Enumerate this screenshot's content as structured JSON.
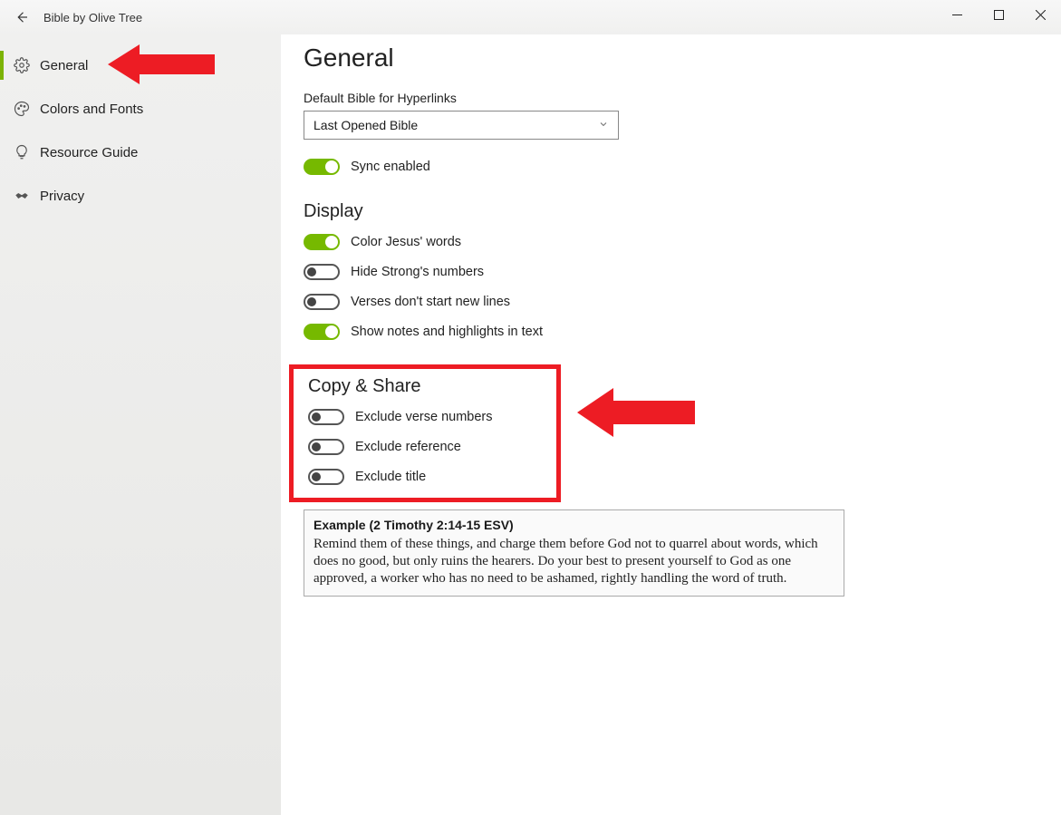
{
  "app": {
    "title": "Bible by Olive Tree"
  },
  "sidebar": {
    "items": [
      {
        "label": "General"
      },
      {
        "label": "Colors and Fonts"
      },
      {
        "label": "Resource Guide"
      },
      {
        "label": "Privacy"
      }
    ]
  },
  "page": {
    "title": "General",
    "default_bible_label": "Default Bible for Hyperlinks",
    "default_bible_value": "Last Opened Bible",
    "sync_label": "Sync enabled",
    "display_heading": "Display",
    "display_toggles": [
      {
        "label": "Color Jesus' words",
        "on": true
      },
      {
        "label": "Hide Strong's numbers",
        "on": false
      },
      {
        "label": "Verses don't start new lines",
        "on": false
      },
      {
        "label": "Show notes and highlights in text",
        "on": true
      }
    ],
    "copy_heading": "Copy & Share",
    "copy_toggles": [
      {
        "label": "Exclude verse numbers",
        "on": false
      },
      {
        "label": "Exclude reference",
        "on": false
      },
      {
        "label": "Exclude title",
        "on": false
      }
    ],
    "example_heading": "Example (2 Timothy 2:14-15 ESV)",
    "example_body": "Remind them of these things, and charge them before God not to quarrel about words, which does no good, but only ruins the hearers. Do your best to present yourself to God as one approved, a worker who has no need to be ashamed, rightly handling the word of truth."
  },
  "colors": {
    "accent": "#76b900",
    "red": "#ed1c24"
  }
}
